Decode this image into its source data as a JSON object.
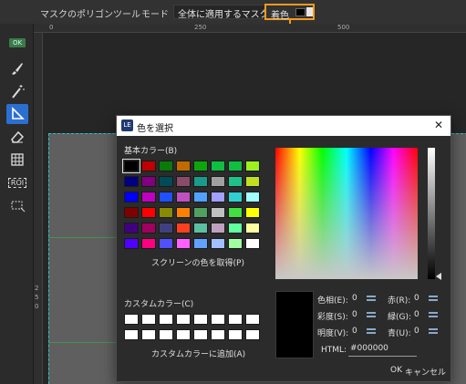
{
  "option_bar": {
    "tool_name": "マスクのポリゴンツール",
    "mode_label": "モード",
    "mode_value": "全体に適用するマスク",
    "mode_arrow": "▾",
    "color_label": "着色",
    "color_value": "#000000",
    "highlight_color": "#f29b1c"
  },
  "toolbar": {
    "ok_badge": "OK",
    "roi_label": "ROI",
    "tools": [
      "brush-icon",
      "magic-wand-icon",
      "polygon-mask-icon",
      "eraser-icon",
      "grid-icon",
      "roi-icon",
      "transform-icon"
    ],
    "active_tool": "polygon-mask-icon",
    "active_color": "#2c6fd1"
  },
  "ruler": {
    "h_ticks": [
      "0",
      "250",
      "500"
    ],
    "v_ticks": [
      "2",
      "5",
      "0"
    ]
  },
  "dialog": {
    "title": "色を選択",
    "app_icon_text": "LE",
    "close_label": "✕",
    "basic_colors_label": "基本カラー(B)",
    "basic_colors": [
      "#000000",
      "#c00000",
      "#0a7a0a",
      "#c06a00",
      "#0ca60c",
      "#0fbf3f",
      "#0fbf3f",
      "#9cf020",
      "#000080",
      "#800080",
      "#004a5a",
      "#8a4a6a",
      "#1a9a8a",
      "#a0a0a0",
      "#20c08a",
      "#c0e020",
      "#0000ff",
      "#c000c0",
      "#2050ff",
      "#c050c0",
      "#50a0ff",
      "#a0a0ff",
      "#30d0d0",
      "#a0ffff",
      "#800000",
      "#ff0000",
      "#8a8a00",
      "#ff8000",
      "#50a060",
      "#c0c0c0",
      "#40e040",
      "#ffff00",
      "#400080",
      "#a00060",
      "#404080",
      "#ff4020",
      "#5ac0a0",
      "#c0a0c0",
      "#60ffa0",
      "#ffffa0",
      "#5000ff",
      "#ff0080",
      "#5050ff",
      "#ff60ff",
      "#60a0ff",
      "#a0c0ff",
      "#a0ffa0",
      "#ffffff"
    ],
    "selected_basic": 0,
    "pick_screen_label": "スクリーンの色を取得(P)",
    "custom_colors_label": "カスタムカラー(C)",
    "custom_colors": [
      "#ffffff",
      "#ffffff",
      "#ffffff",
      "#ffffff",
      "#ffffff",
      "#ffffff",
      "#ffffff",
      "#ffffff",
      "#ffffff",
      "#ffffff",
      "#ffffff",
      "#ffffff",
      "#ffffff",
      "#ffffff",
      "#ffffff",
      "#ffffff"
    ],
    "add_custom_label": "カスタムカラーに追加(A)",
    "fields": {
      "hue": {
        "label": "色相(E):",
        "value": "0"
      },
      "sat": {
        "label": "彩度(S):",
        "value": "0"
      },
      "val": {
        "label": "明度(V):",
        "value": "0"
      },
      "red": {
        "label": "赤(R):",
        "value": "0"
      },
      "green": {
        "label": "緑(G):",
        "value": "0"
      },
      "blue": {
        "label": "青(U):",
        "value": "0"
      }
    },
    "html_label": "HTML:",
    "html_value": "#000000",
    "ok_label": "OK",
    "cancel_label": "キャンセル"
  }
}
